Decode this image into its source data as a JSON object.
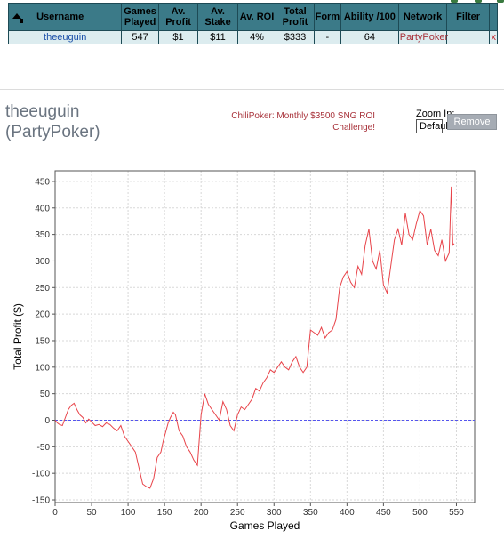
{
  "table": {
    "headers": {
      "username": "Username",
      "games_played": "Games Played",
      "av_profit": "Av. Profit",
      "av_stake": "Av. Stake",
      "av_roi": "Av. ROI",
      "total_profit": "Total Profit",
      "form": "Form",
      "ability": "Ability /100",
      "network": "Network",
      "filter": "Filter"
    },
    "row": {
      "username": "theeuguin",
      "games_played": "547",
      "av_profit": "$1",
      "av_stake": "$11",
      "av_roi": "4%",
      "total_profit": "$333",
      "form": "-",
      "ability": "64",
      "network": "PartyPoker",
      "filter": "",
      "remove_x": "x"
    }
  },
  "player": {
    "name": "theeuguin",
    "network": "(PartyPoker)"
  },
  "promo": {
    "line1": "ChiliPoker: Monthly $3500 SNG ROI",
    "line2": "Challenge!"
  },
  "zoom": {
    "label": "Zoom In:",
    "selected": "Default"
  },
  "remove_button": "Remove",
  "colors": {
    "header_bg": "#3b7a88",
    "row_bg": "#dcecef",
    "line": "#e8444a",
    "zero_line": "#5555ee"
  },
  "chart_data": {
    "type": "line",
    "xlabel": "Games Played",
    "ylabel": "Total Profit ($)",
    "xlim": [
      0,
      575
    ],
    "ylim": [
      -155,
      470
    ],
    "xticks": [
      0,
      50,
      100,
      150,
      200,
      250,
      300,
      350,
      400,
      450,
      500,
      550
    ],
    "yticks": [
      -150,
      -100,
      -50,
      0,
      50,
      100,
      150,
      200,
      250,
      300,
      350,
      400,
      450
    ],
    "grid": true,
    "baseline": 0,
    "series": [
      {
        "x": [
          0,
          3,
          6,
          10,
          14,
          18,
          22,
          26,
          30,
          34,
          38,
          42,
          46,
          50,
          55,
          60,
          65,
          70,
          75,
          80,
          85,
          90,
          95,
          100,
          105,
          110,
          115,
          120,
          125,
          130,
          135,
          140,
          145,
          148,
          152,
          155,
          158,
          162,
          165,
          170,
          175,
          180,
          185,
          190,
          195,
          200,
          205,
          210,
          215,
          220,
          225,
          230,
          235,
          240,
          245,
          250,
          255,
          260,
          265,
          270,
          275,
          280,
          285,
          290,
          295,
          300,
          305,
          310,
          315,
          320,
          325,
          330,
          335,
          340,
          345,
          350,
          355,
          360,
          365,
          370,
          375,
          380,
          385,
          390,
          395,
          400,
          405,
          410,
          415,
          420,
          425,
          430,
          435,
          440,
          445,
          450,
          455,
          460,
          465,
          470,
          475,
          480,
          485,
          490,
          495,
          500,
          505,
          510,
          515,
          520,
          525,
          530,
          535,
          540,
          543,
          545,
          547
        ],
        "y": [
          0,
          -5,
          -8,
          -10,
          5,
          20,
          28,
          32,
          20,
          10,
          5,
          -5,
          2,
          -3,
          -10,
          -8,
          -12,
          -5,
          -8,
          -15,
          -20,
          -10,
          -30,
          -40,
          -50,
          -60,
          -90,
          -120,
          -125,
          -128,
          -110,
          -70,
          -60,
          -40,
          -20,
          -5,
          5,
          15,
          10,
          -20,
          -30,
          -50,
          -60,
          -75,
          -85,
          10,
          50,
          30,
          20,
          10,
          0,
          35,
          20,
          -10,
          -20,
          10,
          25,
          20,
          30,
          40,
          60,
          55,
          70,
          80,
          95,
          90,
          100,
          110,
          100,
          95,
          110,
          120,
          100,
          90,
          100,
          170,
          165,
          160,
          175,
          155,
          165,
          170,
          190,
          250,
          270,
          280,
          260,
          250,
          290,
          275,
          330,
          360,
          300,
          285,
          320,
          255,
          240,
          290,
          340,
          360,
          330,
          390,
          350,
          340,
          370,
          395,
          385,
          330,
          360,
          320,
          310,
          340,
          300,
          315,
          440,
          330,
          333
        ]
      }
    ]
  }
}
